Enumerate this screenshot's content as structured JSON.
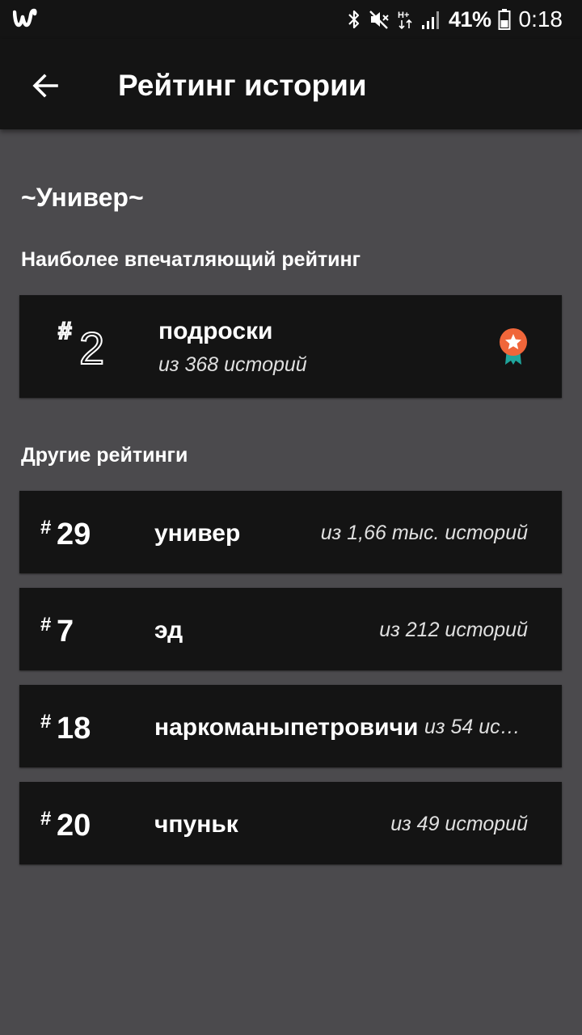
{
  "status_bar": {
    "app_icon": "wattpad-w-icon",
    "icons": [
      "bluetooth-icon",
      "mute-icon",
      "hplus-data-icon",
      "signal-icon"
    ],
    "battery_percent": "41%",
    "battery_icon": "battery-icon",
    "time": "0:18"
  },
  "app_bar": {
    "back_icon": "arrow-left-icon",
    "title": "Рейтинг истории"
  },
  "story": {
    "title": "~Универ~"
  },
  "featured": {
    "section_label": "Наиболее впечатляющий рейтинг",
    "hash": "#",
    "rank": "2",
    "tag": "подроски",
    "count": "из 368 историй",
    "medal_icon": "medal-star-icon",
    "medal_color": "#f0663a",
    "ribbon_color": "#1fa59c"
  },
  "others": {
    "section_label": "Другие рейтинги",
    "items": [
      {
        "hash": "#",
        "rank": "29",
        "tag": "универ",
        "count": "из 1,66 тыс. историй"
      },
      {
        "hash": "#",
        "rank": "7",
        "tag": "эд",
        "count": "из 212 историй"
      },
      {
        "hash": "#",
        "rank": "18",
        "tag": "наркоманыпетровичи",
        "count": "из 54 ист..."
      },
      {
        "hash": "#",
        "rank": "20",
        "tag": "чпуньк",
        "count": "из 49 историй"
      }
    ]
  },
  "colors": {
    "background": "#4b4a4d",
    "card": "#141414",
    "bar": "#141414",
    "text": "#ffffff"
  }
}
